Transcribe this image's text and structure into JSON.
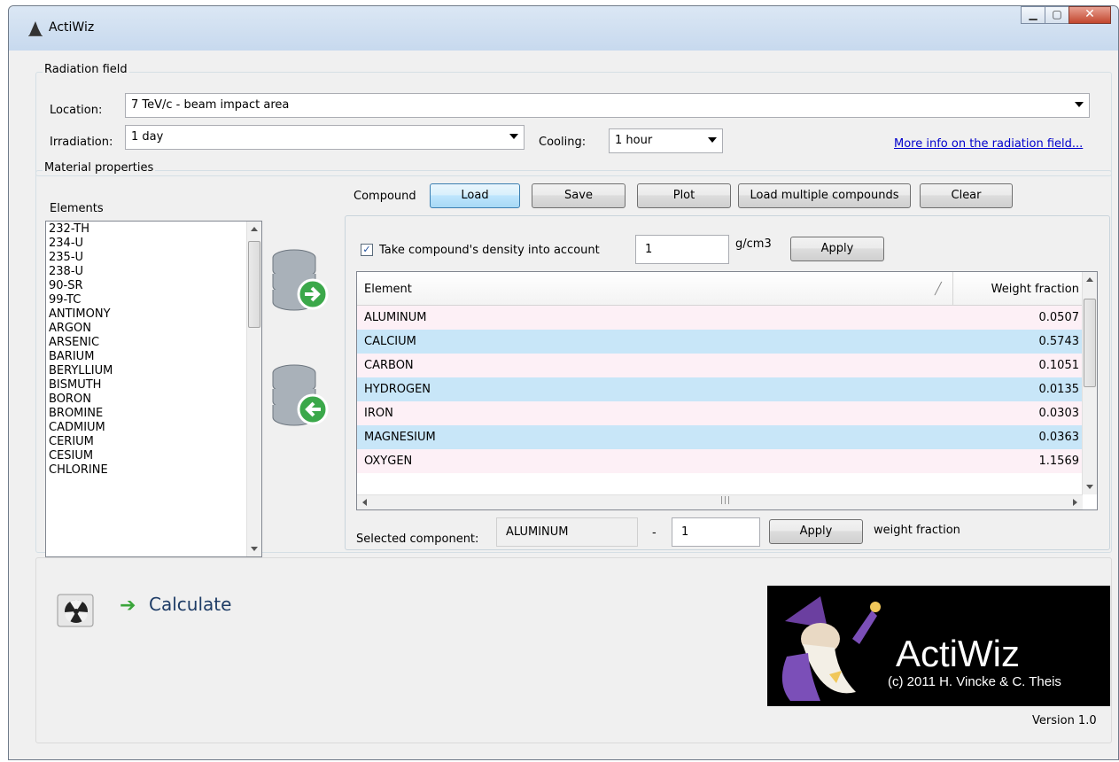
{
  "window": {
    "title": "ActiWiz"
  },
  "radiation_field": {
    "group_label": "Radiation field",
    "location_label": "Location:",
    "location_value": "7 TeV/c - beam impact area",
    "irradiation_label": "Irradiation:",
    "irradiation_value": "1 day",
    "cooling_label": "Cooling:",
    "cooling_value": "1 hour",
    "info_link": "More info on the radiation field..."
  },
  "material": {
    "group_label": "Material properties",
    "elements_label": "Elements",
    "elements": [
      "232-TH",
      "234-U",
      "235-U",
      "238-U",
      "90-SR",
      "99-TC",
      "ANTIMONY",
      "ARGON",
      "ARSENIC",
      "BARIUM",
      "BERYLLIUM",
      "BISMUTH",
      "BORON",
      "BROMINE",
      "CADMIUM",
      "CERIUM",
      "CESIUM",
      "CHLORINE"
    ],
    "compound_label": "Compound",
    "buttons": {
      "load": "Load",
      "save": "Save",
      "plot": "Plot",
      "load_multiple": "Load multiple compounds",
      "clear": "Clear"
    },
    "density": {
      "checkbox_label": "Take compound's density into account",
      "checked": true,
      "value": "1",
      "unit": "g/cm3",
      "apply": "Apply"
    },
    "table": {
      "columns": [
        "Element",
        "Weight fraction"
      ],
      "rows": [
        {
          "element": "ALUMINUM",
          "fraction": "0.0507"
        },
        {
          "element": "CALCIUM",
          "fraction": "0.5743"
        },
        {
          "element": "CARBON",
          "fraction": "0.1051"
        },
        {
          "element": "HYDROGEN",
          "fraction": "0.0135"
        },
        {
          "element": "IRON",
          "fraction": "0.0303"
        },
        {
          "element": "MAGNESIUM",
          "fraction": "0.0363"
        },
        {
          "element": "OXYGEN",
          "fraction": "1.1569"
        }
      ],
      "row_colors": [
        "#fdf0f6",
        "#c8e6f8"
      ]
    },
    "selected": {
      "label": "Selected component:",
      "value": "ALUMINUM",
      "separator": "-",
      "fraction": "1",
      "apply": "Apply",
      "unit_label": "weight fraction"
    }
  },
  "footer": {
    "calculate": "Calculate",
    "logo_title": "ActiWiz",
    "logo_sub": "(c) 2011 H. Vincke & C. Theis",
    "version": "Version 1.0"
  }
}
